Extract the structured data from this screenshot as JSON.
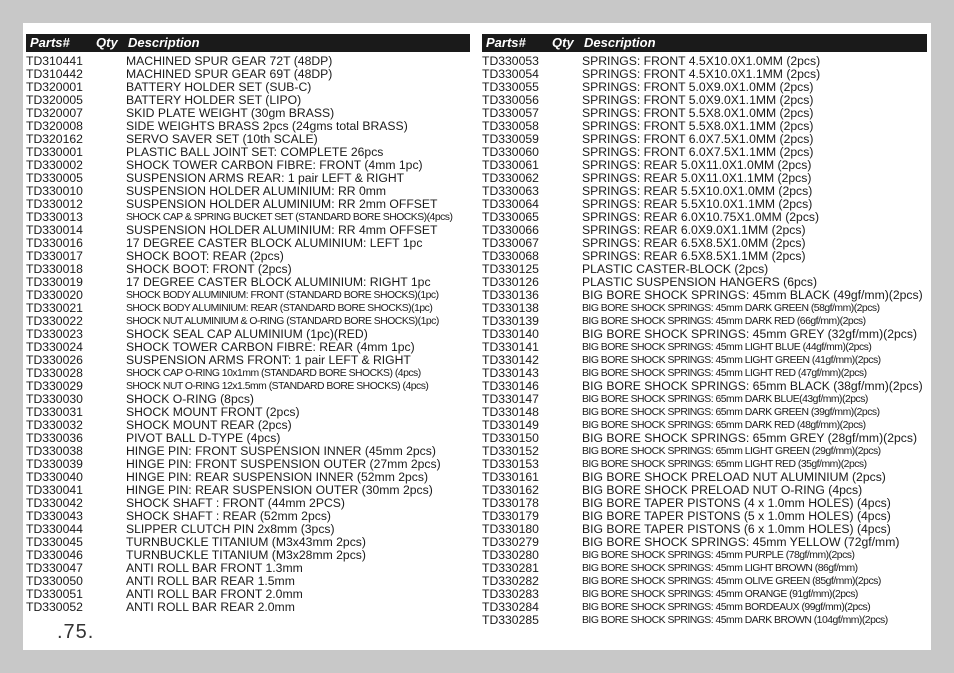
{
  "header": {
    "parts": "Parts#",
    "qty": "Qty",
    "desc": "Description"
  },
  "left": [
    {
      "pn": "TD310441",
      "desc": "MACHINED SPUR GEAR 72T (48DP)"
    },
    {
      "pn": "TD310442",
      "desc": "MACHINED SPUR GEAR 69T (48DP)"
    },
    {
      "pn": "TD320001",
      "desc": "BATTERY HOLDER SET (SUB-C)"
    },
    {
      "pn": "TD320005",
      "desc": "BATTERY HOLDER SET (LIPO)"
    },
    {
      "pn": "TD320007",
      "desc": "SKID PLATE WEIGHT (30gm BRASS)"
    },
    {
      "pn": "TD320008",
      "desc": "SIDE WEIGHTS BRASS 2pcs (24gms total BRASS)"
    },
    {
      "pn": "TD320162",
      "desc": "SERVO SAVER SET (10th SCALE)"
    },
    {
      "pn": "TD330001",
      "desc": "PLASTIC BALL JOINT SET: COMPLETE 26pcs"
    },
    {
      "pn": "TD330002",
      "desc": "SHOCK TOWER CARBON FIBRE: FRONT (4mm 1pc)"
    },
    {
      "pn": "TD330005",
      "desc": "SUSPENSION ARMS REAR: 1 pair LEFT & RIGHT"
    },
    {
      "pn": "TD330010",
      "desc": "SUSPENSION HOLDER ALUMINIUM: RR 0mm"
    },
    {
      "pn": "TD330012",
      "desc": "SUSPENSION HOLDER ALUMINIUM: RR 2mm OFFSET"
    },
    {
      "pn": "TD330013",
      "desc": "SHOCK CAP & SPRING BUCKET SET (STANDARD BORE SHOCKS)(4pcs)",
      "small": true
    },
    {
      "pn": "TD330014",
      "desc": "SUSPENSION HOLDER ALUMINIUM: RR 4mm OFFSET"
    },
    {
      "pn": "TD330016",
      "desc": "17 DEGREE CASTER BLOCK ALUMINIUM: LEFT 1pc"
    },
    {
      "pn": "TD330017",
      "desc": "SHOCK BOOT: REAR (2pcs)"
    },
    {
      "pn": "TD330018",
      "desc": "SHOCK BOOT: FRONT (2pcs)"
    },
    {
      "pn": "TD330019",
      "desc": "17 DEGREE CASTER BLOCK ALUMINIUM: RIGHT 1pc"
    },
    {
      "pn": "TD330020",
      "desc": "SHOCK BODY ALUMINIUM: FRONT (STANDARD BORE SHOCKS)(1pc)",
      "small": true
    },
    {
      "pn": "TD330021",
      "desc": "SHOCK BODY ALUMINIUM: REAR (STANDARD BORE SHOCKS)(1pc)",
      "small": true
    },
    {
      "pn": "TD330022",
      "desc": "SHOCK NUT ALUMINIUM & O-RING (STANDARD BORE SHOCKS)(1pc)",
      "small": true
    },
    {
      "pn": "TD330023",
      "desc": "SHOCK SEAL CAP ALUMINIUM (1pc)(RED)"
    },
    {
      "pn": "TD330024",
      "desc": "SHOCK TOWER CARBON FIBRE: REAR (4mm 1pc)"
    },
    {
      "pn": "TD330026",
      "desc": "SUSPENSION ARMS FRONT: 1 pair LEFT & RIGHT"
    },
    {
      "pn": "TD330028",
      "desc": "SHOCK CAP O-RING 10x1mm (STANDARD BORE SHOCKS) (4pcs)",
      "small": true
    },
    {
      "pn": "TD330029",
      "desc": "SHOCK NUT O-RING 12x1.5mm (STANDARD BORE SHOCKS) (4pcs)",
      "small": true
    },
    {
      "pn": "TD330030",
      "desc": "SHOCK O-RING (8pcs)"
    },
    {
      "pn": "TD330031",
      "desc": "SHOCK MOUNT FRONT (2pcs)"
    },
    {
      "pn": "TD330032",
      "desc": "SHOCK MOUNT REAR (2pcs)"
    },
    {
      "pn": "TD330036",
      "desc": "PIVOT BALL D-TYPE (4pcs)"
    },
    {
      "pn": "TD330038",
      "desc": "HINGE PIN: FRONT SUSPENSION INNER (45mm 2pcs)"
    },
    {
      "pn": "TD330039",
      "desc": "HINGE PIN: FRONT SUSPENSION OUTER (27mm 2pcs)"
    },
    {
      "pn": "TD330040",
      "desc": "HINGE PIN: REAR SUSPENSION INNER (52mm 2pcs)"
    },
    {
      "pn": "TD330041",
      "desc": "HINGE PIN: REAR SUSPENSION OUTER (30mm 2pcs)"
    },
    {
      "pn": "TD330042",
      "desc": "SHOCK SHAFT : FRONT (44mm 2PCS)"
    },
    {
      "pn": "TD330043",
      "desc": "SHOCK SHAFT : REAR (52mm 2pcs)"
    },
    {
      "pn": "TD330044",
      "desc": "SLIPPER CLUTCH PIN 2x8mm (3pcs)"
    },
    {
      "pn": "TD330045",
      "desc": "TURNBUCKLE TITANIUM (M3x43mm 2pcs)"
    },
    {
      "pn": "TD330046",
      "desc": "TURNBUCKLE TITANIUM (M3x28mm 2pcs)"
    },
    {
      "pn": "TD330047",
      "desc": "ANTI ROLL BAR FRONT 1.3mm"
    },
    {
      "pn": "TD330050",
      "desc": "ANTI ROLL BAR REAR 1.5mm"
    },
    {
      "pn": "TD330051",
      "desc": "ANTI ROLL BAR FRONT 2.0mm"
    },
    {
      "pn": "TD330052",
      "desc": "ANTI ROLL BAR REAR 2.0mm"
    }
  ],
  "right": [
    {
      "pn": "TD330053",
      "desc": "SPRINGS: FRONT 4.5X10.0X1.0MM (2pcs)"
    },
    {
      "pn": "TD330054",
      "desc": "SPRINGS: FRONT 4.5X10.0X1.1MM (2pcs)"
    },
    {
      "pn": "TD330055",
      "desc": "SPRINGS: FRONT 5.0X9.0X1.0MM (2pcs)"
    },
    {
      "pn": "TD330056",
      "desc": "SPRINGS: FRONT 5.0X9.0X1.1MM (2pcs)"
    },
    {
      "pn": "TD330057",
      "desc": "SPRINGS: FRONT 5.5X8.0X1.0MM (2pcs)"
    },
    {
      "pn": "TD330058",
      "desc": "SPRINGS: FRONT 5.5X8.0X1.1MM (2pcs)"
    },
    {
      "pn": "TD330059",
      "desc": "SPRINGS: FRONT 6.0X7.5X1.0MM (2pcs)"
    },
    {
      "pn": "TD330060",
      "desc": "SPRINGS: FRONT 6.0X7.5X1.1MM (2pcs)"
    },
    {
      "pn": "TD330061",
      "desc": "SPRINGS: REAR 5.0X11.0X1.0MM (2pcs)"
    },
    {
      "pn": "TD330062",
      "desc": "SPRINGS: REAR 5.0X11.0X1.1MM (2pcs)"
    },
    {
      "pn": "TD330063",
      "desc": "SPRINGS: REAR 5.5X10.0X1.0MM (2pcs)"
    },
    {
      "pn": "TD330064",
      "desc": "SPRINGS: REAR 5.5X10.0X1.1MM (2pcs)"
    },
    {
      "pn": "TD330065",
      "desc": "SPRINGS: REAR 6.0X10.75X1.0MM (2pcs)"
    },
    {
      "pn": "TD330066",
      "desc": "SPRINGS: REAR 6.0X9.0X1.1MM (2pcs)"
    },
    {
      "pn": "TD330067",
      "desc": "SPRINGS: REAR 6.5X8.5X1.0MM (2pcs)"
    },
    {
      "pn": "TD330068",
      "desc": "SPRINGS: REAR 6.5X8.5X1.1MM (2pcs)"
    },
    {
      "pn": "TD330125",
      "desc": "PLASTIC CASTER-BLOCK (2pcs)"
    },
    {
      "pn": "TD330126",
      "desc": "PLASTIC SUSPENSION HANGERS (6pcs)"
    },
    {
      "pn": "TD330136",
      "desc": "BIG BORE SHOCK SPRINGS: 45mm BLACK (49gf/mm)(2pcs)"
    },
    {
      "pn": "TD330138",
      "desc": "BIG BORE SHOCK SPRINGS: 45mm DARK GREEN (58gf/mm)(2pcs)",
      "small": true
    },
    {
      "pn": "TD330139",
      "desc": "BIG BORE SHOCK SPRINGS: 45mm DARK RED (66gf/mm)(2pcs)",
      "small": true
    },
    {
      "pn": "TD330140",
      "desc": "BIG BORE SHOCK SPRINGS: 45mm GREY (32gf/mm)(2pcs)"
    },
    {
      "pn": "TD330141",
      "desc": "BIG BORE SHOCK SPRINGS: 45mm LIGHT BLUE (44gf/mm)(2pcs)",
      "small": true
    },
    {
      "pn": "TD330142",
      "desc": "BIG BORE SHOCK SPRINGS: 45mm LIGHT GREEN (41gf/mm)(2pcs)",
      "small": true
    },
    {
      "pn": "TD330143",
      "desc": "BIG BORE SHOCK SPRINGS: 45mm LIGHT RED (47gf/mm)(2pcs)",
      "small": true
    },
    {
      "pn": "TD330146",
      "desc": "BIG BORE SHOCK SPRINGS: 65mm BLACK (38gf/mm)(2pcs)"
    },
    {
      "pn": "TD330147",
      "desc": "BIG BORE SHOCK SPRINGS: 65mm DARK BLUE(43gf/mm)(2pcs)",
      "small": true
    },
    {
      "pn": "TD330148",
      "desc": "BIG BORE SHOCK SPRINGS: 65mm DARK GREEN (39gf/mm)(2pcs)",
      "small": true
    },
    {
      "pn": "TD330149",
      "desc": "BIG BORE SHOCK SPRINGS: 65mm DARK RED (48gf/mm)(2pcs)",
      "small": true
    },
    {
      "pn": "TD330150",
      "desc": "BIG BORE SHOCK SPRINGS: 65mm GREY (28gf/mm)(2pcs)"
    },
    {
      "pn": "TD330152",
      "desc": "BIG BORE SHOCK SPRINGS: 65mm LIGHT GREEN (29gf/mm)(2pcs)",
      "small": true
    },
    {
      "pn": "TD330153",
      "desc": "BIG BORE SHOCK SPRINGS: 65mm LIGHT RED (35gf/mm)(2pcs)",
      "small": true
    },
    {
      "pn": "TD330161",
      "desc": "BIG BORE SHOCK PRELOAD NUT ALUMINIUM (2pcs)"
    },
    {
      "pn": "TD330162",
      "desc": "BIG BORE SHOCK PRELOAD NUT O-RING (4pcs)"
    },
    {
      "pn": "TD330178",
      "desc": "BIG BORE TAPER PISTONS (4 x 1.0mm HOLES) (4pcs)"
    },
    {
      "pn": "TD330179",
      "desc": "BIG BORE TAPER PISTONS (5 x 1.0mm HOLES) (4pcs)"
    },
    {
      "pn": "TD330180",
      "desc": "BIG BORE TAPER PISTONS (6 x 1.0mm HOLES) (4pcs)"
    },
    {
      "pn": "TD330279",
      "desc": "BIG BORE SHOCK SPRINGS: 45mm YELLOW (72gf/mm)"
    },
    {
      "pn": "TD330280",
      "desc": "BIG BORE SHOCK SPRINGS: 45mm PURPLE (78gf/mm)(2pcs)",
      "small": true
    },
    {
      "pn": "TD330281",
      "desc": "BIG BORE SHOCK SPRINGS: 45mm LIGHT BROWN (86gf/mm)",
      "small": true
    },
    {
      "pn": "TD330282",
      "desc": "BIG BORE SHOCK SPRINGS: 45mm OLIVE GREEN (85gf/mm)(2pcs)",
      "small": true
    },
    {
      "pn": "TD330283",
      "desc": "BIG BORE  SHOCK SPRINGS: 45mm ORANGE (91gf/mm)(2pcs)",
      "small": true
    },
    {
      "pn": "TD330284",
      "desc": "BIG BORE SHOCK SPRINGS: 45mm BORDEAUX (99gf/mm)(2pcs)",
      "small": true
    },
    {
      "pn": "TD330285",
      "desc": "BIG BORE SHOCK SPRINGS: 45mm DARK BROWN (104gf/mm)(2pcs)",
      "small": true
    }
  ],
  "page_number": ".75."
}
